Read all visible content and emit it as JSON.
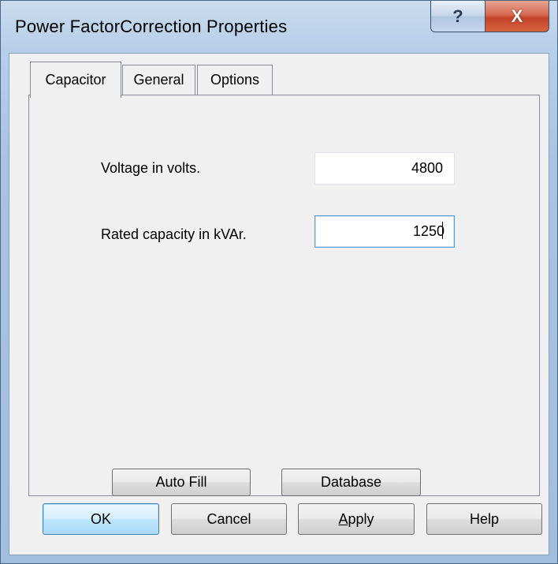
{
  "window": {
    "title": "Power FactorCorrection Properties",
    "help_glyph": "?",
    "close_glyph": "X"
  },
  "tabs": [
    {
      "label": "Capacitor",
      "active": true
    },
    {
      "label": "General",
      "active": false
    },
    {
      "label": "Options",
      "active": false
    }
  ],
  "capacitor": {
    "voltage_label": "Voltage in volts.",
    "voltage_value": "4800",
    "rated_label": "Rated capacity in kVAr.",
    "rated_value": "1250",
    "autofill_label": "Auto Fill",
    "database_label": "Database"
  },
  "footer": {
    "ok_label": "OK",
    "cancel_label": "Cancel",
    "apply_label_mnemonic": "A",
    "apply_label_rest": "pply",
    "help_label": "Help"
  },
  "colors": {
    "titlebar": "#b7cfe8",
    "close_button": "#c2432a",
    "focus_border": "#5b9bd5",
    "default_button": "#a7d9f5"
  }
}
